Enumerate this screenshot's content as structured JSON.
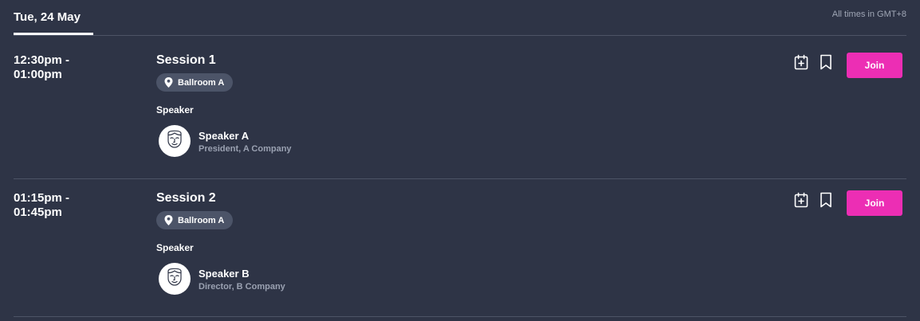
{
  "header": {
    "date_tab": "Tue, 24 May",
    "timezone_note": "All times in GMT+8"
  },
  "sessions": [
    {
      "time_start": "12:30pm -",
      "time_end": "01:00pm",
      "title": "Session 1",
      "location": "Ballroom A",
      "speaker_heading": "Speaker",
      "speaker": {
        "name": "Speaker A",
        "role": "President, A Company"
      },
      "join_label": "Join"
    },
    {
      "time_start": "01:15pm -",
      "time_end": "01:45pm",
      "title": "Session 2",
      "location": "Ballroom A",
      "speaker_heading": "Speaker",
      "speaker": {
        "name": "Speaker B",
        "role": "Director, B Company"
      },
      "join_label": "Join"
    }
  ],
  "icons": {
    "location": "map-pin-icon",
    "add_to_calendar": "calendar-plus-icon",
    "bookmark": "bookmark-icon",
    "avatar": "face-icon"
  },
  "colors": {
    "background": "#2e3446",
    "accent": "#ec2eb4",
    "pill": "#4c5468",
    "muted_text": "#9aa1b1",
    "divider": "#4d5466"
  }
}
